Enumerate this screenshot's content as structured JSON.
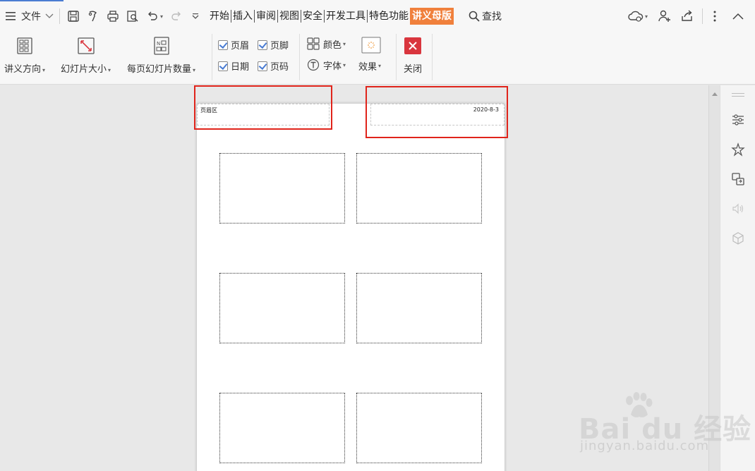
{
  "menubar": {
    "file_label": "文件",
    "tabs": [
      {
        "label": "开始"
      },
      {
        "label": "插入"
      },
      {
        "label": "审阅"
      },
      {
        "label": "视图"
      },
      {
        "label": "安全"
      },
      {
        "label": "开发工具"
      },
      {
        "label": "特色功能"
      },
      {
        "label": "讲义母版"
      }
    ],
    "search_label": "查找"
  },
  "ribbon": {
    "handout_orientation": "讲义方向",
    "slide_size": "幻灯片大小",
    "slides_per_page": "每页幻灯片数量",
    "header_checkbox": "页眉",
    "footer_checkbox": "页脚",
    "date_checkbox": "日期",
    "page_number_checkbox": "页码",
    "colors": "颜色",
    "fonts": "字体",
    "effects": "效果",
    "close": "关闭"
  },
  "page": {
    "header_text": "页眉区",
    "date_text": "2020-8-3"
  },
  "watermark": {
    "brand": "Bai du 经验",
    "url": "jingyan.baidu.com"
  },
  "colors": {
    "accent": "#f0803c",
    "highlight": "#e0241b",
    "close_button": "#d9363e"
  }
}
